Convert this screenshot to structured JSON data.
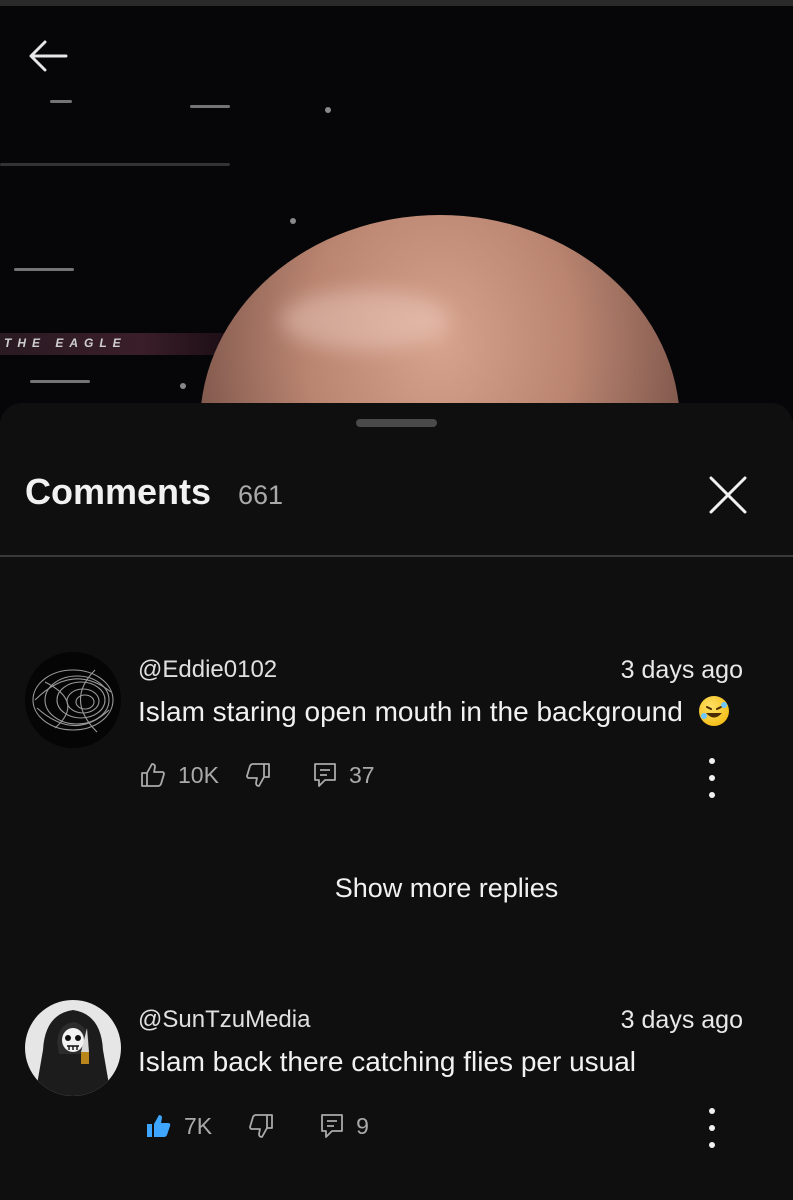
{
  "video": {
    "banner_text": "THE EAGLE"
  },
  "comments_panel": {
    "title": "Comments",
    "count": "661",
    "show_more_label": "Show more replies",
    "comments": [
      {
        "handle": "@Eddie0102",
        "time": "3 days ago",
        "text": "Islam staring open mouth in the background",
        "emoji": "rolling-on-floor-laughing",
        "likes": "10K",
        "liked": false,
        "replies": "37"
      },
      {
        "handle": "@SunTzuMedia",
        "time": "3 days ago",
        "text": "Islam back there catching flies per usual",
        "likes": "7K",
        "liked": true,
        "replies": "9"
      }
    ]
  },
  "colors": {
    "background": "#0f0f0f",
    "text_primary": "#f1f1f1",
    "text_secondary": "#aaaaaa",
    "like_active": "#3ea6ff"
  }
}
